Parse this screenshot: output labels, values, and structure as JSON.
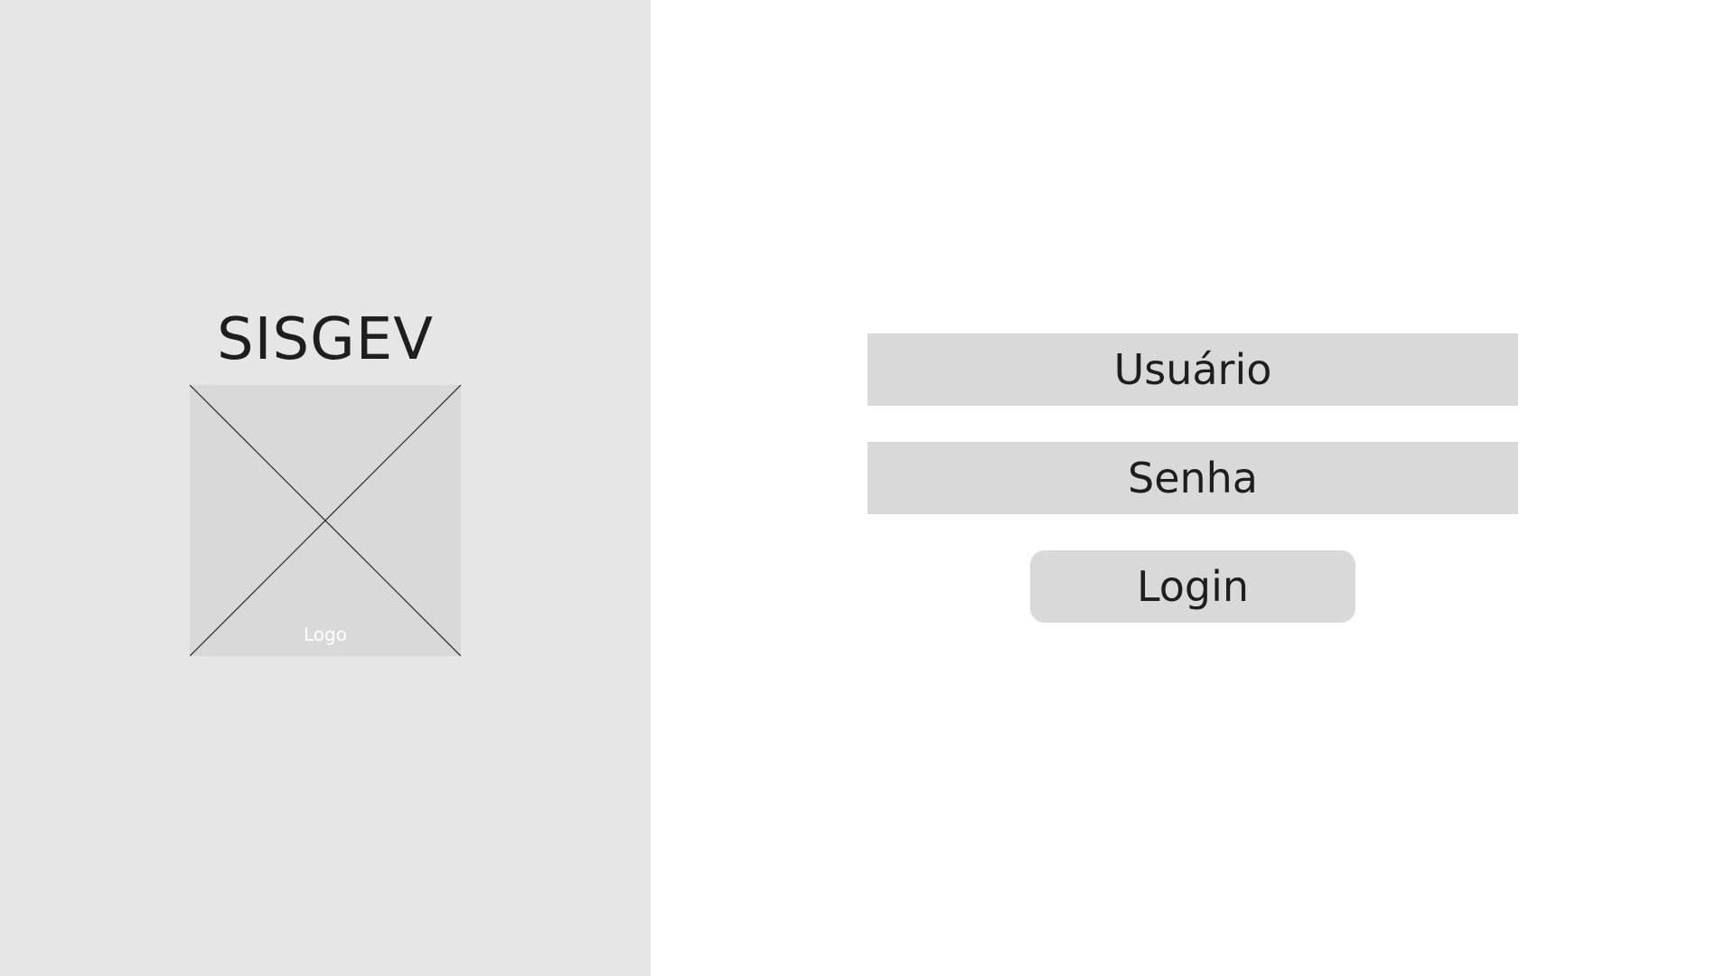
{
  "branding": {
    "app_title": "SISGEV",
    "logo_label": "Logo",
    "logo_placeholder_icon": "image-placeholder-icon"
  },
  "login_form": {
    "username_placeholder": "Usuário",
    "password_placeholder": "Senha",
    "login_label": "Login"
  },
  "colors": {
    "left_panel_bg": "#e6e6e6",
    "right_panel_bg": "#ffffff",
    "control_bg": "#d9d9d9",
    "text": "#1e1e1e",
    "logo_label": "#ffffff"
  }
}
